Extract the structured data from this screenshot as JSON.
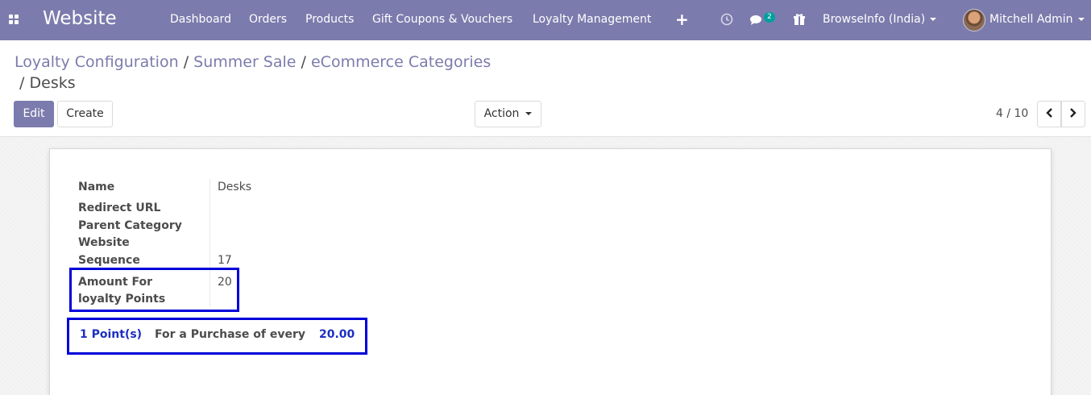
{
  "navbar": {
    "brand": "Website",
    "menu": [
      "Dashboard",
      "Orders",
      "Products",
      "Gift Coupons & Vouchers",
      "Loyalty Management"
    ],
    "plus_icon": "+",
    "messages_count": "2",
    "company": "BrowseInfo (India)",
    "user": "Mitchell Admin"
  },
  "breadcrumb": {
    "items": [
      "Loyalty Configuration",
      "Summer Sale",
      "eCommerce Categories"
    ],
    "separator": "/",
    "current": "Desks"
  },
  "controls": {
    "edit_label": "Edit",
    "create_label": "Create",
    "action_label": "Action",
    "pager": "4 / 10"
  },
  "form": {
    "fields": [
      {
        "label": "Name",
        "value": "Desks"
      },
      {
        "label": "Redirect URL",
        "value": ""
      },
      {
        "label": "Parent Category",
        "value": ""
      },
      {
        "label": "Website",
        "value": ""
      },
      {
        "label": "Sequence",
        "value": "17"
      },
      {
        "label": "Amount For loyalty Points",
        "value": "20"
      }
    ],
    "summary": {
      "points": "1 Point(s)",
      "text": "For a Purchase of every",
      "amount": "20.00"
    }
  },
  "colors": {
    "primary": "#7c7bad",
    "highlight_box": "#0000d9",
    "summary_blue": "#1c2fc2",
    "badge": "#00a09d"
  },
  "icons": [
    "apps-icon",
    "plus-icon",
    "clock-icon",
    "chat-icon",
    "gift-icon",
    "caret-down-icon",
    "chevron-left-icon",
    "chevron-right-icon"
  ]
}
